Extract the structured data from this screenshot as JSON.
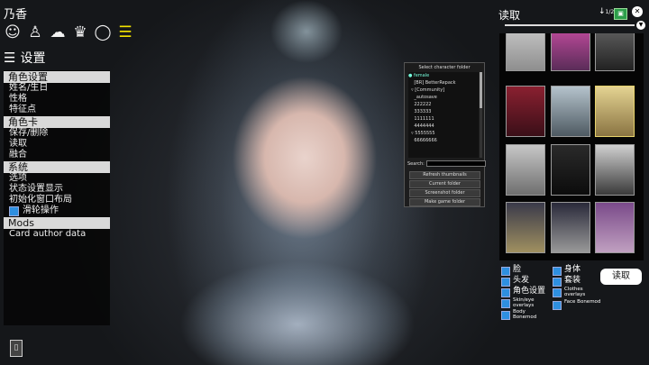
{
  "character_name": "乃香",
  "tabs": [
    "face-icon",
    "body-icon",
    "hair-icon",
    "clothes-icon",
    "accessory-icon",
    "list-icon"
  ],
  "settings_title": "设置",
  "menu": {
    "sections": [
      {
        "title": "角色设置",
        "items": [
          "姓名/生日",
          "性格",
          "特征点"
        ]
      },
      {
        "title": "角色卡",
        "items": [
          "保存/删除",
          "读取",
          "融合"
        ]
      },
      {
        "title": "系统",
        "items": [
          "选项",
          "状态设置显示",
          "初始化窗口布局"
        ],
        "check_item": "滑轮操作"
      },
      {
        "title": "Mods",
        "items": [
          "Card author data"
        ]
      }
    ]
  },
  "folder_dialog": {
    "title": "Select character folder",
    "folders": [
      "female",
      "[BR] BetterRepack",
      "[Community]",
      "_autosave",
      "222222",
      "333333",
      "1111111",
      "4444444",
      "5555555",
      "66666666"
    ],
    "search_label": "Search:",
    "buttons": [
      "Refresh thumbnails",
      "Current folder",
      "Screenshot folder",
      "Make game folder"
    ]
  },
  "right_panel": {
    "title": "读取",
    "sort_label": "1/2"
  },
  "categories": [
    {
      "label": "脸"
    },
    {
      "label": "头发"
    },
    {
      "label": "角色设置"
    },
    {
      "label": "Skin/eye overlays"
    },
    {
      "label": "Body Bonemod"
    },
    {
      "label": "身体"
    },
    {
      "label": "套装"
    },
    {
      "label": "Clothes overlays"
    },
    {
      "label": "Face Bonemod"
    }
  ],
  "load_button": "读取",
  "colors": {
    "active_tab": "#f1e200",
    "checkbox": "#2e8fe0",
    "section_bg": "#d9d9d9"
  }
}
